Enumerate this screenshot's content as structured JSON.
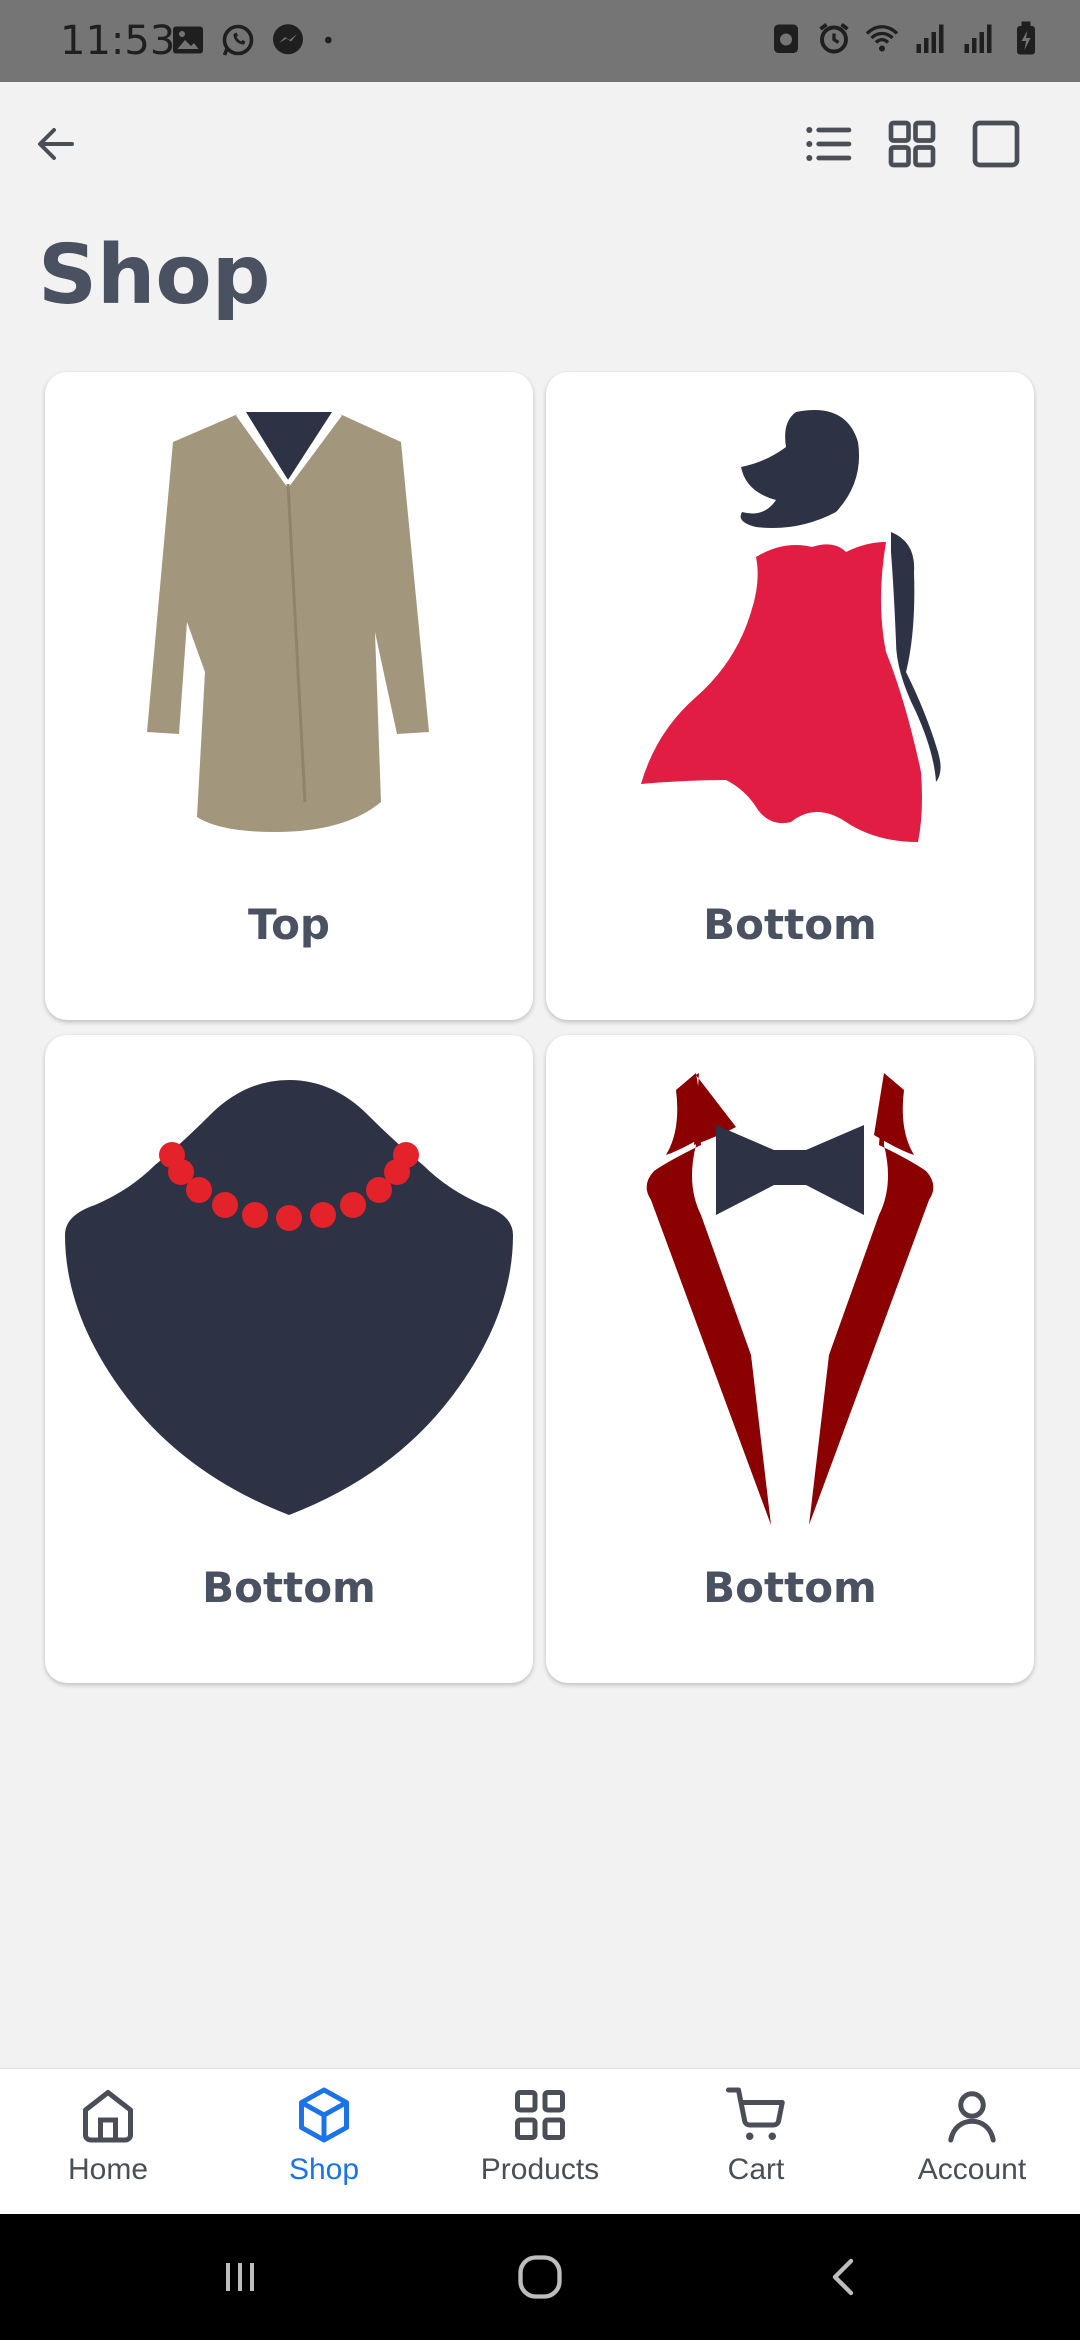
{
  "status_bar": {
    "time": "11:53",
    "left_icons": [
      "gallery-icon",
      "whatsapp-icon",
      "messenger-icon",
      "dot-icon"
    ],
    "right_icons": [
      "battery-saver-icon",
      "alarm-icon",
      "wifi-icon",
      "signal-icon",
      "signal-icon",
      "battery-icon"
    ]
  },
  "top_bar": {
    "back_icon": "arrow-left-icon",
    "view_icons": [
      "list-view-icon",
      "grid-view-icon",
      "single-view-icon"
    ]
  },
  "page": {
    "title": "Shop"
  },
  "categories": [
    {
      "label": "Top",
      "icon": "coat-icon"
    },
    {
      "label": "Bottom",
      "icon": "dress-icon"
    },
    {
      "label": "Bottom",
      "icon": "necklace-icon"
    },
    {
      "label": "Bottom",
      "icon": "tuxedo-icon"
    }
  ],
  "bottom_nav": {
    "active": "Shop",
    "active_color": "#1a73e8",
    "items": [
      {
        "label": "Home",
        "icon": "home-icon"
      },
      {
        "label": "Shop",
        "icon": "box-icon"
      },
      {
        "label": "Products",
        "icon": "grid-icon"
      },
      {
        "label": "Cart",
        "icon": "cart-icon"
      },
      {
        "label": "Account",
        "icon": "user-icon"
      }
    ]
  },
  "system_nav": [
    "recents-icon",
    "home-circle-icon",
    "back-chevron-icon"
  ]
}
